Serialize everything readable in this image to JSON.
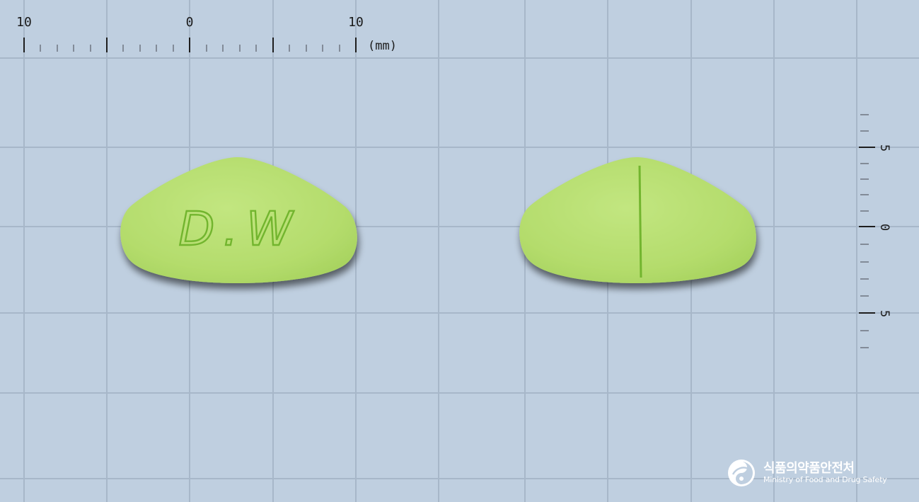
{
  "ruler_top": {
    "labels": [
      "10",
      "0",
      "10"
    ],
    "unit": "(mm)"
  },
  "ruler_right": {
    "labels": [
      "5",
      "0",
      "5"
    ]
  },
  "pill_front": {
    "imprint": "D.W",
    "color": "#b6df72"
  },
  "pill_back": {
    "score_line": "single vertical score",
    "color": "#b6df72"
  },
  "colors": {
    "background": "#bfcfe0",
    "grid_line": "#a6b6c8",
    "imprint": "#6fb22e"
  },
  "logo": {
    "korean": "식품의약품안전처",
    "english": "Ministry of Food and Drug Safety",
    "icon": "mfds-emblem-icon"
  }
}
